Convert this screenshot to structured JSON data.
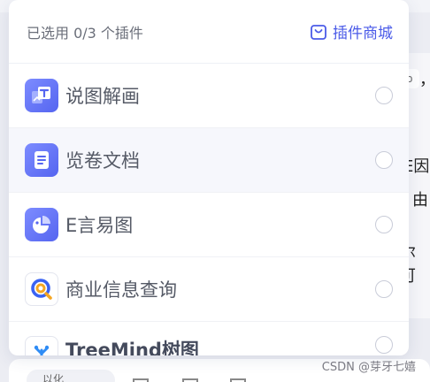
{
  "picker": {
    "selected_text": "已选用 0/3 个插件",
    "store_label": "插件商城"
  },
  "plugins": [
    {
      "name": "说图解画"
    },
    {
      "name": "览卷文档"
    },
    {
      "name": "E言易图"
    },
    {
      "name": "商业信息查询"
    },
    {
      "name": "TreeMind树图"
    }
  ],
  "background": {
    "code_snippet": "o",
    "comma": "，",
    "text_fragments": [
      "E因",
      "由",
      "尔可"
    ],
    "input_placeholder": "以化"
  },
  "watermark": "CSDN @芽牙七嬉",
  "colors": {
    "accent": "#4b5be8",
    "icon_gradient_start": "#7d8cff",
    "icon_gradient_end": "#5565f0",
    "orange": "#f5a623",
    "radio_border": "#c9ccd8"
  }
}
